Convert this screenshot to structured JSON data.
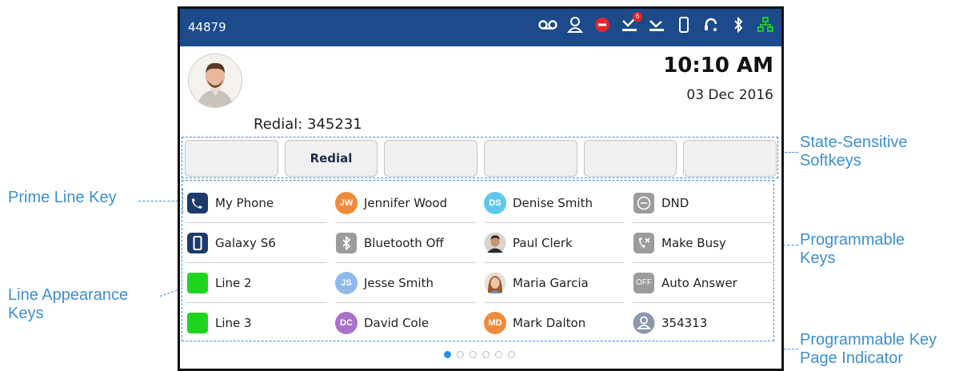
{
  "callouts": {
    "state_sensitive_1": "State-Sensitive",
    "state_sensitive_2": "Softkeys",
    "prime_line": "Prime Line Key",
    "line_appearance_1": "Line Appearance",
    "line_appearance_2": "Keys",
    "programmable_1": "Programmable",
    "programmable_2": "Keys",
    "page_indicator_1": "Programmable Key",
    "page_indicator_2": "Page Indicator"
  },
  "status_bar": {
    "extension": "44879",
    "icons": [
      "voicemail-icon",
      "presence-icon",
      "dnd-icon",
      "missed-calls-icon",
      "call-forward-icon",
      "mobile-icon",
      "headset-icon",
      "bluetooth-icon",
      "network-icon"
    ],
    "missed_count": "6",
    "colors": {
      "bar": "#1c4a8b",
      "dnd": "#e2262b",
      "network": "#1ed41e"
    }
  },
  "idle": {
    "time": "10:10 AM",
    "date": "03 Dec 2016",
    "redial": "Redial: 345231"
  },
  "softkeys": [
    "",
    "Redial",
    "",
    "",
    "",
    ""
  ],
  "programmable_keys": {
    "col1": [
      {
        "label": "My Phone",
        "icon": "phone-icon"
      },
      {
        "label": "Galaxy S6",
        "icon": "mobile-icon"
      },
      {
        "label": "Line 2",
        "icon": "line-status-icon"
      },
      {
        "label": "Line 3",
        "icon": "line-status-icon"
      }
    ],
    "col2": [
      {
        "label": "Jennifer Wood",
        "initials": "JW",
        "color": "#f28a3c"
      },
      {
        "label": "Bluetooth Off",
        "icon": "bluetooth-icon"
      },
      {
        "label": "Jesse Smith",
        "initials": "JS",
        "color": "#8fb9ea"
      },
      {
        "label": "David Cole",
        "initials": "DC",
        "color": "#a772c8"
      }
    ],
    "col3": [
      {
        "label": "Denise Smith",
        "initials": "DS",
        "color": "#5fc7ee"
      },
      {
        "label": "Paul Clerk",
        "icon": "contact-photo"
      },
      {
        "label": "Maria Garcia",
        "icon": "contact-photo"
      },
      {
        "label": "Mark Dalton",
        "initials": "MD",
        "color": "#f28a3c"
      }
    ],
    "col4": [
      {
        "label": "DND",
        "icon": "dnd-icon"
      },
      {
        "label": "Make Busy",
        "icon": "make-busy-icon"
      },
      {
        "label": "Auto Answer",
        "icon": "off-icon",
        "icon_text": "OFF"
      },
      {
        "label": "354313",
        "icon": "contact-icon"
      }
    ]
  },
  "page_indicator": {
    "pages": 6,
    "current": 1
  }
}
